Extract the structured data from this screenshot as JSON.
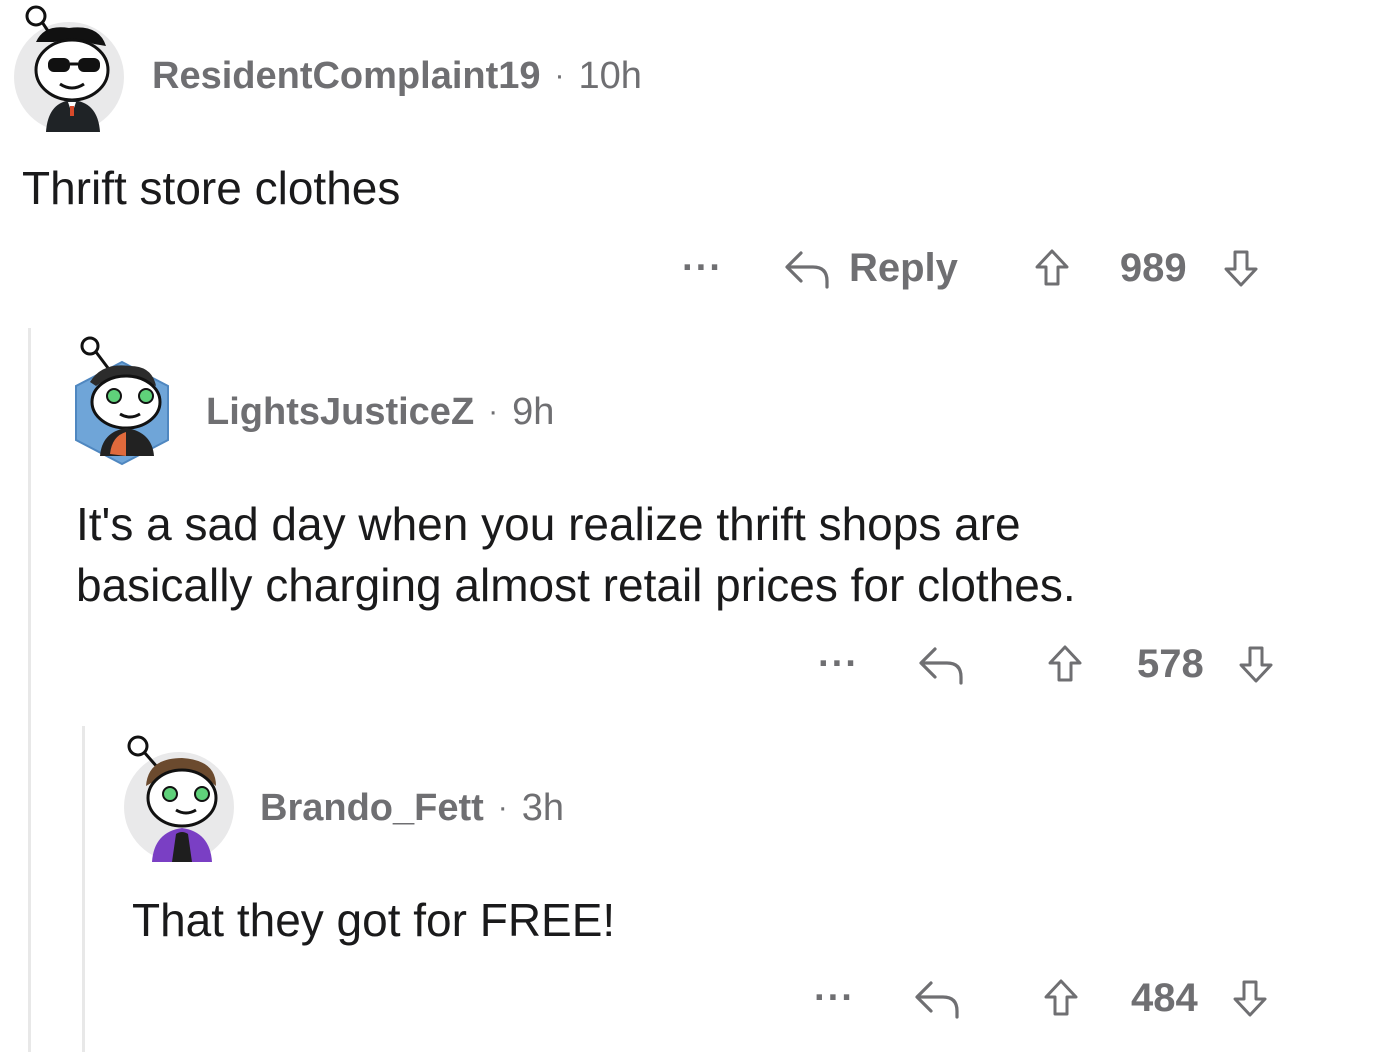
{
  "comments": [
    {
      "username": "ResidentComplaint19",
      "separator": "·",
      "time": "10h",
      "text": "Thrift store clothes",
      "more_label": "···",
      "reply_label": "Reply",
      "score": "989",
      "avatar_icon": "snoo-sunglasses-avatar-icon"
    },
    {
      "username": "LightsJusticeZ",
      "separator": "·",
      "time": "9h",
      "text_line1": "It's a sad day when you realize thrift shops are",
      "text_line2": "basically charging almost retail prices for clothes.",
      "more_label": "···",
      "score": "578",
      "avatar_icon": "snoo-hexagon-avatar-icon"
    },
    {
      "username": "Brando_Fett",
      "separator": "·",
      "time": "3h",
      "text": "That they got for FREE!",
      "more_label": "···",
      "score": "484",
      "avatar_icon": "snoo-brown-hair-avatar-icon"
    }
  ],
  "colors": {
    "meta_gray": "#6f6f72",
    "text": "#1a1a1b",
    "thread_line": "#e8e8e8"
  }
}
